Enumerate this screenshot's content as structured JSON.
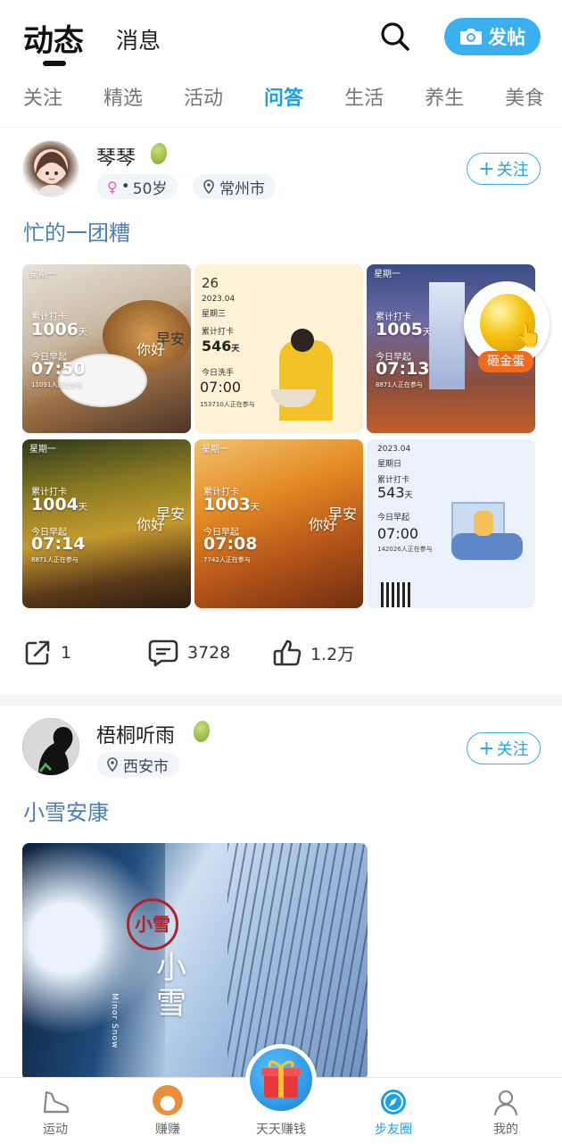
{
  "header": {
    "title_main": "动态",
    "title_sub": "消息",
    "post_button": "发帖"
  },
  "tabs": [
    "关注",
    "精选",
    "活动",
    "问答",
    "生活",
    "养生",
    "美食"
  ],
  "active_tab": "问答",
  "post1": {
    "username": "琴琴",
    "age": "50岁",
    "city": "常州市",
    "follow": "关注",
    "title": "忙的一团糟",
    "images": [
      {
        "weekday": "星期一",
        "label1": "累计打卡",
        "count": "1006",
        "unit": "天",
        "label2": "今日早起",
        "time": "07:50",
        "note": "11091人正在参与"
      },
      {
        "day": "26",
        "date": "2023.04",
        "weekday": "星期三",
        "label1": "累计打卡",
        "count": "546",
        "unit": "天",
        "label2": "今日洗手",
        "time": "07:00",
        "note": "153710人正在参与"
      },
      {
        "weekday": "星期一",
        "label1": "累计打卡",
        "count": "1005",
        "unit": "天",
        "label2": "今日早起",
        "time": "07:13",
        "note": "8871人正在参与"
      },
      {
        "weekday": "星期一",
        "label1": "累计打卡",
        "count": "1004",
        "unit": "天",
        "label2": "今日早起",
        "time": "07:14",
        "note": "8871人正在参与"
      },
      {
        "weekday": "星期一",
        "label1": "累计打卡",
        "count": "1003",
        "unit": "天",
        "label2": "今日早起",
        "time": "07:08",
        "note": "7742人正在参与"
      },
      {
        "date": "2023.04",
        "weekday": "星期日",
        "label1": "累计打卡",
        "count": "543",
        "unit": "天",
        "label2": "今日早起",
        "time": "07:00",
        "note": "142026人正在参与"
      }
    ],
    "greeting_a": "你好",
    "greeting_b": "早安",
    "badge": "砸金蛋",
    "shares": "1",
    "comments": "3728",
    "likes": "1.2万"
  },
  "post2": {
    "username": "梧桐听雨",
    "city": "西安市",
    "follow": "关注",
    "title": "小雪安康",
    "seal": "小雪",
    "big_text": "小雪",
    "small_text": "Minor Snow"
  },
  "nav": [
    {
      "label": "运动",
      "icon": "shoe-icon"
    },
    {
      "label": "赚赚",
      "icon": "shiba-icon"
    },
    {
      "label": "天天赚钱",
      "icon": "gift-icon"
    },
    {
      "label": "步友圈",
      "icon": "compass-icon"
    },
    {
      "label": "我的",
      "icon": "person-icon"
    }
  ],
  "active_nav": "步友圈",
  "colors": {
    "accent": "#1aa0e8",
    "title_blue": "#4b7fb5",
    "button": "#3ab0ef"
  }
}
